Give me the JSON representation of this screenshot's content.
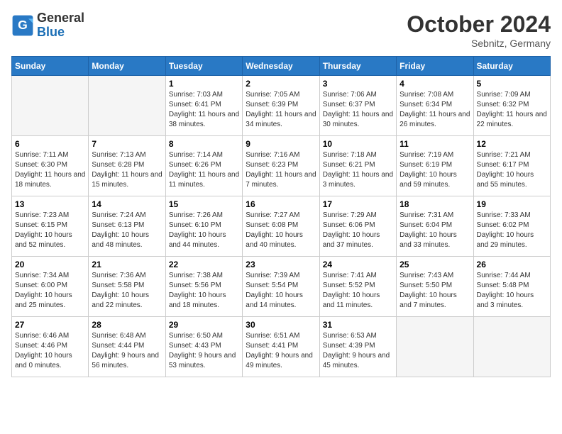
{
  "header": {
    "logo_text_general": "General",
    "logo_text_blue": "Blue",
    "month_title": "October 2024",
    "location": "Sebnitz, Germany"
  },
  "weekdays": [
    "Sunday",
    "Monday",
    "Tuesday",
    "Wednesday",
    "Thursday",
    "Friday",
    "Saturday"
  ],
  "weeks": [
    [
      {
        "day": "",
        "empty": true
      },
      {
        "day": "",
        "empty": true
      },
      {
        "day": "1",
        "sunrise": "7:03 AM",
        "sunset": "6:41 PM",
        "daylight": "11 hours and 38 minutes."
      },
      {
        "day": "2",
        "sunrise": "7:05 AM",
        "sunset": "6:39 PM",
        "daylight": "11 hours and 34 minutes."
      },
      {
        "day": "3",
        "sunrise": "7:06 AM",
        "sunset": "6:37 PM",
        "daylight": "11 hours and 30 minutes."
      },
      {
        "day": "4",
        "sunrise": "7:08 AM",
        "sunset": "6:34 PM",
        "daylight": "11 hours and 26 minutes."
      },
      {
        "day": "5",
        "sunrise": "7:09 AM",
        "sunset": "6:32 PM",
        "daylight": "11 hours and 22 minutes."
      }
    ],
    [
      {
        "day": "6",
        "sunrise": "7:11 AM",
        "sunset": "6:30 PM",
        "daylight": "11 hours and 18 minutes."
      },
      {
        "day": "7",
        "sunrise": "7:13 AM",
        "sunset": "6:28 PM",
        "daylight": "11 hours and 15 minutes."
      },
      {
        "day": "8",
        "sunrise": "7:14 AM",
        "sunset": "6:26 PM",
        "daylight": "11 hours and 11 minutes."
      },
      {
        "day": "9",
        "sunrise": "7:16 AM",
        "sunset": "6:23 PM",
        "daylight": "11 hours and 7 minutes."
      },
      {
        "day": "10",
        "sunrise": "7:18 AM",
        "sunset": "6:21 PM",
        "daylight": "11 hours and 3 minutes."
      },
      {
        "day": "11",
        "sunrise": "7:19 AM",
        "sunset": "6:19 PM",
        "daylight": "10 hours and 59 minutes."
      },
      {
        "day": "12",
        "sunrise": "7:21 AM",
        "sunset": "6:17 PM",
        "daylight": "10 hours and 55 minutes."
      }
    ],
    [
      {
        "day": "13",
        "sunrise": "7:23 AM",
        "sunset": "6:15 PM",
        "daylight": "10 hours and 52 minutes."
      },
      {
        "day": "14",
        "sunrise": "7:24 AM",
        "sunset": "6:13 PM",
        "daylight": "10 hours and 48 minutes."
      },
      {
        "day": "15",
        "sunrise": "7:26 AM",
        "sunset": "6:10 PM",
        "daylight": "10 hours and 44 minutes."
      },
      {
        "day": "16",
        "sunrise": "7:27 AM",
        "sunset": "6:08 PM",
        "daylight": "10 hours and 40 minutes."
      },
      {
        "day": "17",
        "sunrise": "7:29 AM",
        "sunset": "6:06 PM",
        "daylight": "10 hours and 37 minutes."
      },
      {
        "day": "18",
        "sunrise": "7:31 AM",
        "sunset": "6:04 PM",
        "daylight": "10 hours and 33 minutes."
      },
      {
        "day": "19",
        "sunrise": "7:33 AM",
        "sunset": "6:02 PM",
        "daylight": "10 hours and 29 minutes."
      }
    ],
    [
      {
        "day": "20",
        "sunrise": "7:34 AM",
        "sunset": "6:00 PM",
        "daylight": "10 hours and 25 minutes."
      },
      {
        "day": "21",
        "sunrise": "7:36 AM",
        "sunset": "5:58 PM",
        "daylight": "10 hours and 22 minutes."
      },
      {
        "day": "22",
        "sunrise": "7:38 AM",
        "sunset": "5:56 PM",
        "daylight": "10 hours and 18 minutes."
      },
      {
        "day": "23",
        "sunrise": "7:39 AM",
        "sunset": "5:54 PM",
        "daylight": "10 hours and 14 minutes."
      },
      {
        "day": "24",
        "sunrise": "7:41 AM",
        "sunset": "5:52 PM",
        "daylight": "10 hours and 11 minutes."
      },
      {
        "day": "25",
        "sunrise": "7:43 AM",
        "sunset": "5:50 PM",
        "daylight": "10 hours and 7 minutes."
      },
      {
        "day": "26",
        "sunrise": "7:44 AM",
        "sunset": "5:48 PM",
        "daylight": "10 hours and 3 minutes."
      }
    ],
    [
      {
        "day": "27",
        "sunrise": "6:46 AM",
        "sunset": "4:46 PM",
        "daylight": "10 hours and 0 minutes."
      },
      {
        "day": "28",
        "sunrise": "6:48 AM",
        "sunset": "4:44 PM",
        "daylight": "9 hours and 56 minutes."
      },
      {
        "day": "29",
        "sunrise": "6:50 AM",
        "sunset": "4:43 PM",
        "daylight": "9 hours and 53 minutes."
      },
      {
        "day": "30",
        "sunrise": "6:51 AM",
        "sunset": "4:41 PM",
        "daylight": "9 hours and 49 minutes."
      },
      {
        "day": "31",
        "sunrise": "6:53 AM",
        "sunset": "4:39 PM",
        "daylight": "9 hours and 45 minutes."
      },
      {
        "day": "",
        "empty": true
      },
      {
        "day": "",
        "empty": true
      }
    ]
  ]
}
